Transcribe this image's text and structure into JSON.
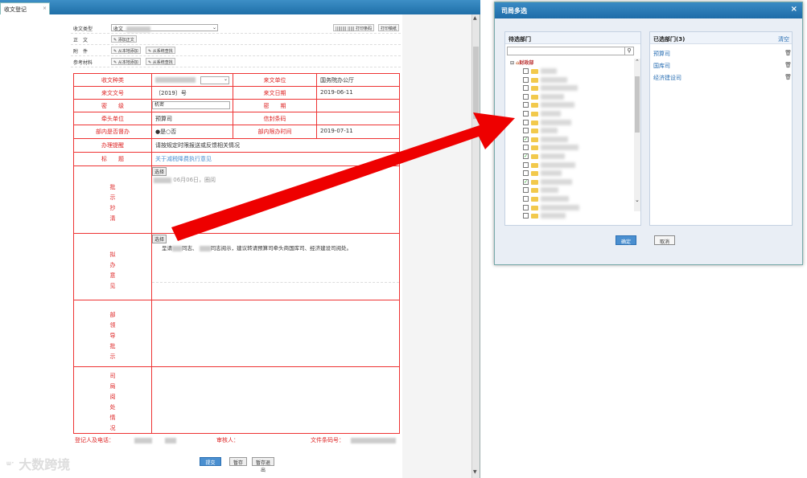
{
  "tab": {
    "label": "收文登记",
    "close": "×"
  },
  "header": {
    "doc_type_label": "收文类型",
    "doc_type_value": "收文",
    "print_barcode": "|||||||| ||||| 打印条码",
    "print_draft": "打印稿纸",
    "rows": [
      {
        "label": "正　文",
        "btn1": "添加正文",
        "btn2": ""
      },
      {
        "label": "附　件",
        "btn1": "从本地添加",
        "btn2": "从系统查找"
      },
      {
        "label": "参考材料",
        "btn1": "从本地添加",
        "btn2": "从系统查找"
      }
    ]
  },
  "form": {
    "r1": {
      "l1": "收文种类",
      "v1": "",
      "l2": "来文单位",
      "v2": "国务院办公厅"
    },
    "r2": {
      "l1": "来文文号",
      "v1": "〔2019〕号",
      "l2": "来文日期",
      "v2": "2019-06-11"
    },
    "r3": {
      "l1": "密　　级",
      "v1": "机密",
      "l2": "密　　期",
      "v2": ""
    },
    "r4": {
      "l1": "牵头单位",
      "v1": "预算司",
      "l2": "信封条码",
      "v2": ""
    },
    "r5": {
      "l1": "部内是否督办",
      "v1": "●是○否",
      "l2": "部内限办时间",
      "v2": "2019-07-11"
    },
    "r6": {
      "l1": "办理提醒",
      "v1": "请按规定时限报送或反馈相关情况"
    },
    "r7": {
      "l1": "标　　题",
      "v1": "关于减税降费执行意见"
    },
    "s1": {
      "label": "批\n示\n抄\n清",
      "choose": "选择",
      "text": "06月06日，圈阅"
    },
    "s2": {
      "label": "拟\n办\n意\n见",
      "choose": "选择",
      "text_a": "呈请",
      "text_b": "同志、",
      "text_c": "同志阅示，建议转请预算司牵头商国库司、经济建设司阅处。"
    },
    "s3": {
      "label": "部\n领\n导\n批\n示"
    },
    "s4": {
      "label": "司\n局\n阅\n处\n情\n况"
    }
  },
  "footer": {
    "registrant": "登记人及电话：",
    "reviewer": "审核人：",
    "barcode": "文件条码号："
  },
  "buttons": {
    "b1": "提交",
    "b2": "暂存",
    "b3": "暂存退出"
  },
  "watermark": "大数跨境",
  "dialog": {
    "title": "司局多选",
    "close": "×",
    "left_title": "待选部门",
    "right_title": "已选部门(3)",
    "clear": "清空",
    "root": "财政部",
    "checked": [
      false,
      false,
      false,
      false,
      false,
      false,
      false,
      false,
      true,
      false,
      true,
      false,
      false,
      true,
      false,
      false,
      false,
      false
    ],
    "selected": [
      "预算司",
      "国库司",
      "经济建设司"
    ],
    "ok": "确定",
    "cancel": "取消"
  },
  "colors": {
    "accent": "#2a78b6",
    "form_border": "#e33",
    "arrow": "#ee0000"
  }
}
